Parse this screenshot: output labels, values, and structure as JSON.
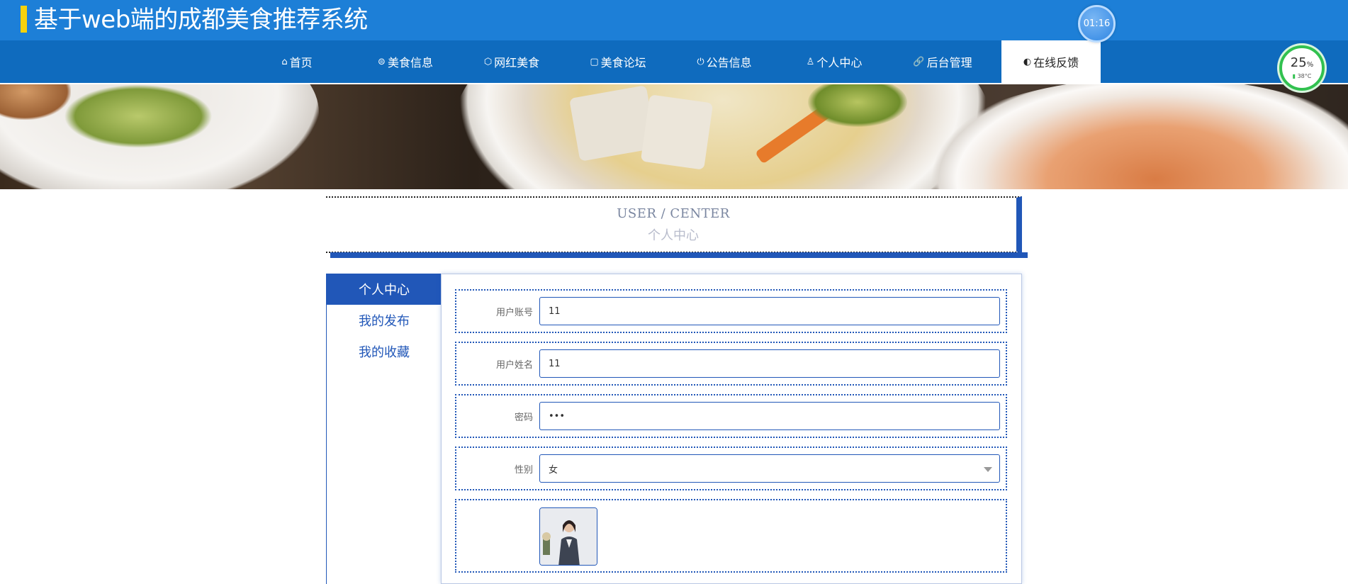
{
  "header": {
    "title": "基于web端的成都美食推荐系统",
    "clock": "01:16"
  },
  "nav": {
    "items": [
      {
        "label": "首页",
        "icon": "home-icon",
        "glyph": "⌂"
      },
      {
        "label": "美食信息",
        "icon": "food-info-icon",
        "glyph": "⊜"
      },
      {
        "label": "网红美食",
        "icon": "cube-icon",
        "glyph": "⬡"
      },
      {
        "label": "美食论坛",
        "icon": "forum-icon",
        "glyph": "▢"
      },
      {
        "label": "公告信息",
        "icon": "power-icon",
        "glyph": "⏻"
      },
      {
        "label": "个人中心",
        "icon": "user-icon",
        "glyph": "♙"
      },
      {
        "label": "后台管理",
        "icon": "link-icon",
        "glyph": "🔗"
      },
      {
        "label": "在线反馈",
        "icon": "feedback-icon",
        "glyph": "◐",
        "active": true
      }
    ]
  },
  "gauge": {
    "value": "25",
    "unit": "%",
    "temp": "38°C"
  },
  "center": {
    "en_title": "USER / CENTER",
    "cn_title": "个人中心"
  },
  "sidebar": {
    "tabs": [
      {
        "label": "个人中心",
        "active": true
      },
      {
        "label": "我的发布"
      },
      {
        "label": "我的收藏"
      }
    ]
  },
  "form": {
    "account": {
      "label": "用户账号",
      "value": "11"
    },
    "name": {
      "label": "用户姓名",
      "value": "11"
    },
    "password": {
      "label": "密码",
      "value": "•••"
    },
    "gender": {
      "label": "性别",
      "value": "女"
    }
  },
  "colors": {
    "header": "#1d7fd7",
    "nav": "#0f6bbe",
    "accent": "#2157b8",
    "title_mark": "#f5d20c"
  }
}
